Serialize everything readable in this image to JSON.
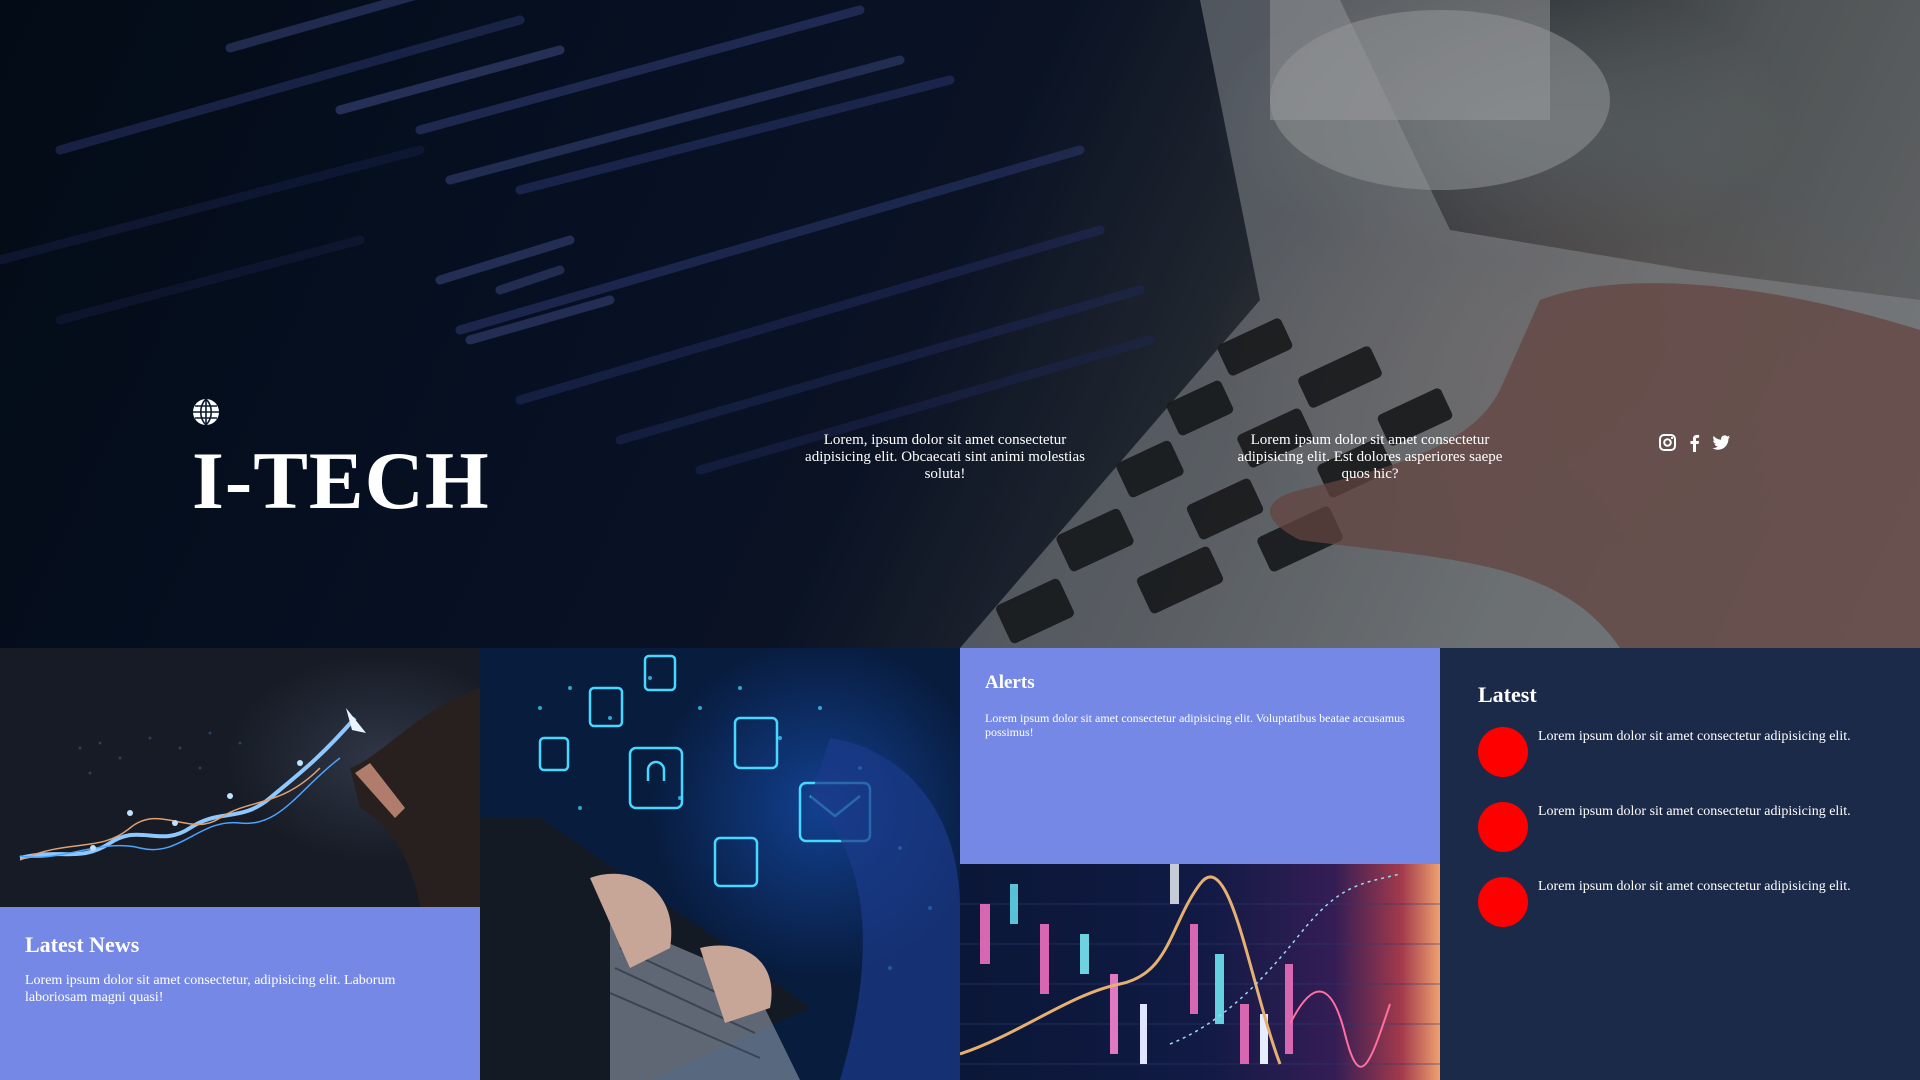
{
  "hero": {
    "logo_icon": "globe-icon",
    "title": "I-TECH",
    "text_1": "Lorem, ipsum dolor sit amet consectetur adipisicing elit. Obcaecati sint animi molestias soluta!",
    "text_2": "Lorem ipsum dolor sit amet consectetur adipisicing elit. Est dolores asperiores saepe quos hic?",
    "social_icons": [
      "instagram-icon",
      "facebook-icon",
      "twitter-icon"
    ]
  },
  "news": {
    "title": "Latest News",
    "body": "Lorem ipsum dolor sit amet consectetur, adipisicing elit. Laborum laboriosam magni quasi!"
  },
  "alerts": {
    "title": "Alerts",
    "body": "Lorem ipsum dolor sit amet consectetur adipisicing elit. Voluptatibus beatae accusamus possimus!"
  },
  "latest": {
    "title": "Latest",
    "items": [
      {
        "text": "Lorem ipsum dolor sit amet consectetur adipisicing elit."
      },
      {
        "text": "Lorem ipsum dolor sit amet consectetur adipisicing elit."
      },
      {
        "text": "Lorem ipsum dolor sit amet consectetur adipisicing elit."
      }
    ]
  },
  "colors": {
    "accent_tile": "#7588e6",
    "dark_panel": "#1c2a4a",
    "dot": "#ff0000"
  }
}
